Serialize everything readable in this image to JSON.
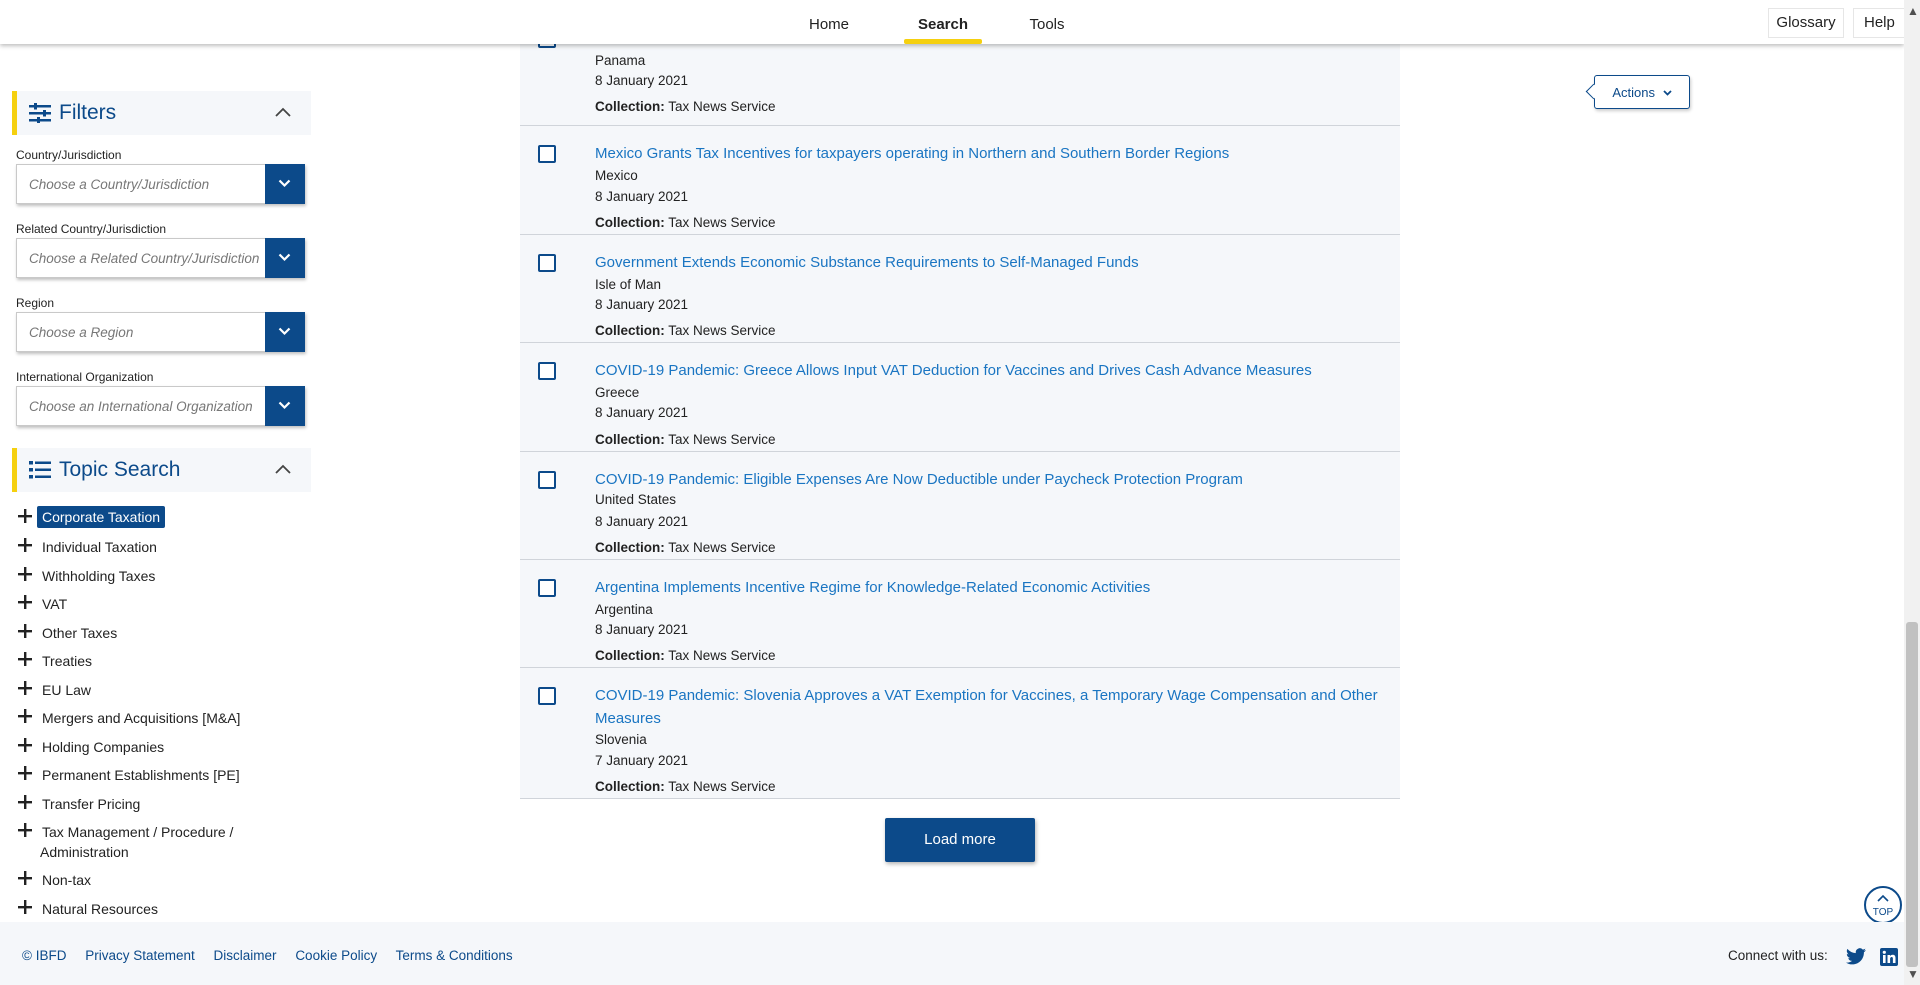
{
  "nav": {
    "home": "Home",
    "search": "Search",
    "tools": "Tools",
    "glossary": "Glossary",
    "help": "Help"
  },
  "filters": {
    "title": "Filters",
    "fields": [
      {
        "label": "Country/Jurisdiction",
        "placeholder": "Choose a Country/Jurisdiction"
      },
      {
        "label": "Related Country/Jurisdiction",
        "placeholder": "Choose a Related Country/Jurisdiction"
      },
      {
        "label": "Region",
        "placeholder": "Choose a Region"
      },
      {
        "label": "International Organization",
        "placeholder": "Choose an International Organization"
      }
    ]
  },
  "topics": {
    "title": "Topic Search",
    "items": [
      "Corporate Taxation",
      "Individual Taxation",
      "Withholding Taxes",
      "VAT",
      "Other Taxes",
      "Treaties",
      "EU Law",
      "Mergers and Acquisitions [M&A]",
      "Holding Companies",
      "Permanent Establishments [PE]",
      "Transfer Pricing",
      "Tax Management / Procedure /",
      "Administration",
      "Non-tax",
      "Natural Resources"
    ]
  },
  "actions": "Actions",
  "results": [
    {
      "location": "Panama",
      "date": "8 January 2021",
      "collection_label": "Collection:",
      "collection": "Tax News Service"
    },
    {
      "title": "Mexico Grants Tax Incentives for taxpayers operating in Northern and Southern Border Regions",
      "location": "Mexico",
      "date": "8 January 2021",
      "collection_label": "Collection:",
      "collection": "Tax News Service"
    },
    {
      "title": "Government Extends Economic Substance Requirements to Self-Managed Funds",
      "location": "Isle of Man",
      "date": "8 January 2021",
      "collection_label": "Collection:",
      "collection": "Tax News Service"
    },
    {
      "title": "COVID-19 Pandemic: Greece Allows Input VAT Deduction for Vaccines and Drives Cash Advance Measures",
      "location": "Greece",
      "date": "8 January 2021",
      "collection_label": "Collection:",
      "collection": "Tax News Service"
    },
    {
      "title": "COVID-19 Pandemic: Eligible Expenses Are Now Deductible under Paycheck Protection Program",
      "location": "United States",
      "date": "8 January 2021",
      "collection_label": "Collection:",
      "collection": "Tax News Service"
    },
    {
      "title": "Argentina Implements Incentive Regime for Knowledge-Related Economic Activities",
      "location": "Argentina",
      "date": "8 January 2021",
      "collection_label": "Collection:",
      "collection": "Tax News Service"
    },
    {
      "title": "COVID-19 Pandemic: Slovenia Approves a VAT Exemption for Vaccines, a Temporary Wage Compensation and Other Measures",
      "location": "Slovenia",
      "date": "7 January 2021",
      "collection_label": "Collection:",
      "collection": "Tax News Service"
    }
  ],
  "load_more": "Load more",
  "top_label": "TOP",
  "footer": {
    "links": [
      "© IBFD",
      "Privacy Statement",
      "Disclaimer",
      "Cookie Policy",
      "Terms & Conditions"
    ],
    "connect": "Connect with us:"
  },
  "colors": {
    "brand": "#0c4a8a",
    "accent": "#f5d00f",
    "link": "#1a75c2"
  }
}
